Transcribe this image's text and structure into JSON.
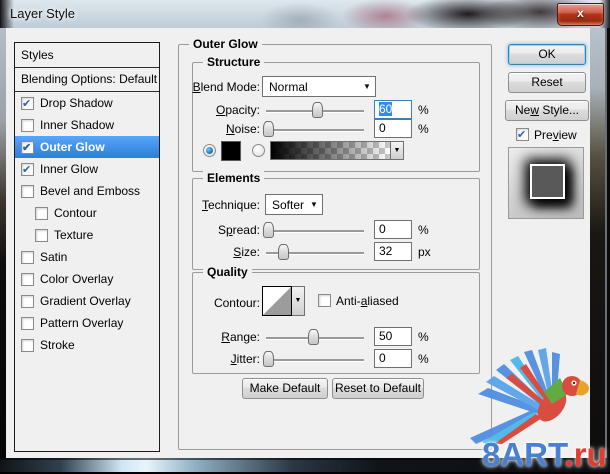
{
  "window": {
    "title": "Layer Style",
    "close_label": "x"
  },
  "sidebar": {
    "header": "Styles",
    "items": [
      {
        "label": "Blending Options: Default"
      },
      {
        "label": "Drop Shadow",
        "checked": true
      },
      {
        "label": "Inner Shadow",
        "checked": false
      },
      {
        "label": "Outer Glow",
        "checked": true,
        "selected": true
      },
      {
        "label": "Inner Glow",
        "checked": true
      },
      {
        "label": "Bevel and Emboss",
        "checked": false
      },
      {
        "label": "Contour",
        "checked": false,
        "indent": true
      },
      {
        "label": "Texture",
        "checked": false,
        "indent": true
      },
      {
        "label": "Satin",
        "checked": false
      },
      {
        "label": "Color Overlay",
        "checked": false
      },
      {
        "label": "Gradient Overlay",
        "checked": false
      },
      {
        "label": "Pattern Overlay",
        "checked": false
      },
      {
        "label": "Stroke",
        "checked": false
      }
    ]
  },
  "panel": {
    "title": "Outer Glow",
    "structure": {
      "title": "Structure",
      "blend_mode": {
        "label": {
          "text": "Blend Mode:",
          "u": 0
        },
        "value": "Normal"
      },
      "opacity": {
        "label": {
          "text": "Opacity:",
          "u": 0
        },
        "value": "60",
        "unit": "%",
        "slider_pct": 52,
        "selected": true
      },
      "noise": {
        "label": {
          "text": "Noise:",
          "u": 0
        },
        "value": "0",
        "unit": "%",
        "slider_pct": 2
      },
      "color_selected": true,
      "gradient_selected": false,
      "color_swatch": "#000000",
      "gradient_arrow": "▼"
    },
    "elements": {
      "title": "Elements",
      "technique": {
        "label": {
          "text": "Technique:",
          "u": 0
        },
        "value": "Softer"
      },
      "spread": {
        "label": {
          "text": "Spread:",
          "u": 1
        },
        "value": "0",
        "unit": "%",
        "slider_pct": 2
      },
      "size": {
        "label": {
          "text": "Size:",
          "u": 0
        },
        "value": "32",
        "unit": "px",
        "slider_pct": 17
      }
    },
    "quality": {
      "title": "Quality",
      "contour_label": {
        "text": "Contour:",
        "u": -1
      },
      "anti_aliased": {
        "label": {
          "text": "Anti-aliased",
          "u": 5
        },
        "checked": false
      },
      "range": {
        "label": {
          "text": "Range:",
          "u": 0
        },
        "value": "50",
        "unit": "%",
        "slider_pct": 48
      },
      "jitter": {
        "label": {
          "text": "Jitter:",
          "u": 0
        },
        "value": "0",
        "unit": "%",
        "slider_pct": 2
      }
    },
    "footer": {
      "make_default": "Make Default",
      "reset_to_default": "Reset to Default"
    }
  },
  "actions": {
    "ok": "OK",
    "reset": "Reset",
    "new_style": {
      "text": "New Style...",
      "u": 2
    },
    "preview": {
      "text": "Preview",
      "u": 3
    },
    "preview_checked": true
  },
  "watermark": {
    "site": "8ART",
    "tld": ".ru",
    "site_color": "#4a80d0",
    "tld_color": "#e23b30"
  },
  "colors": {
    "selection": "#3399ff",
    "client_bg": "#f0f0f0"
  },
  "misc": {
    "combo_arrow": "▼"
  }
}
